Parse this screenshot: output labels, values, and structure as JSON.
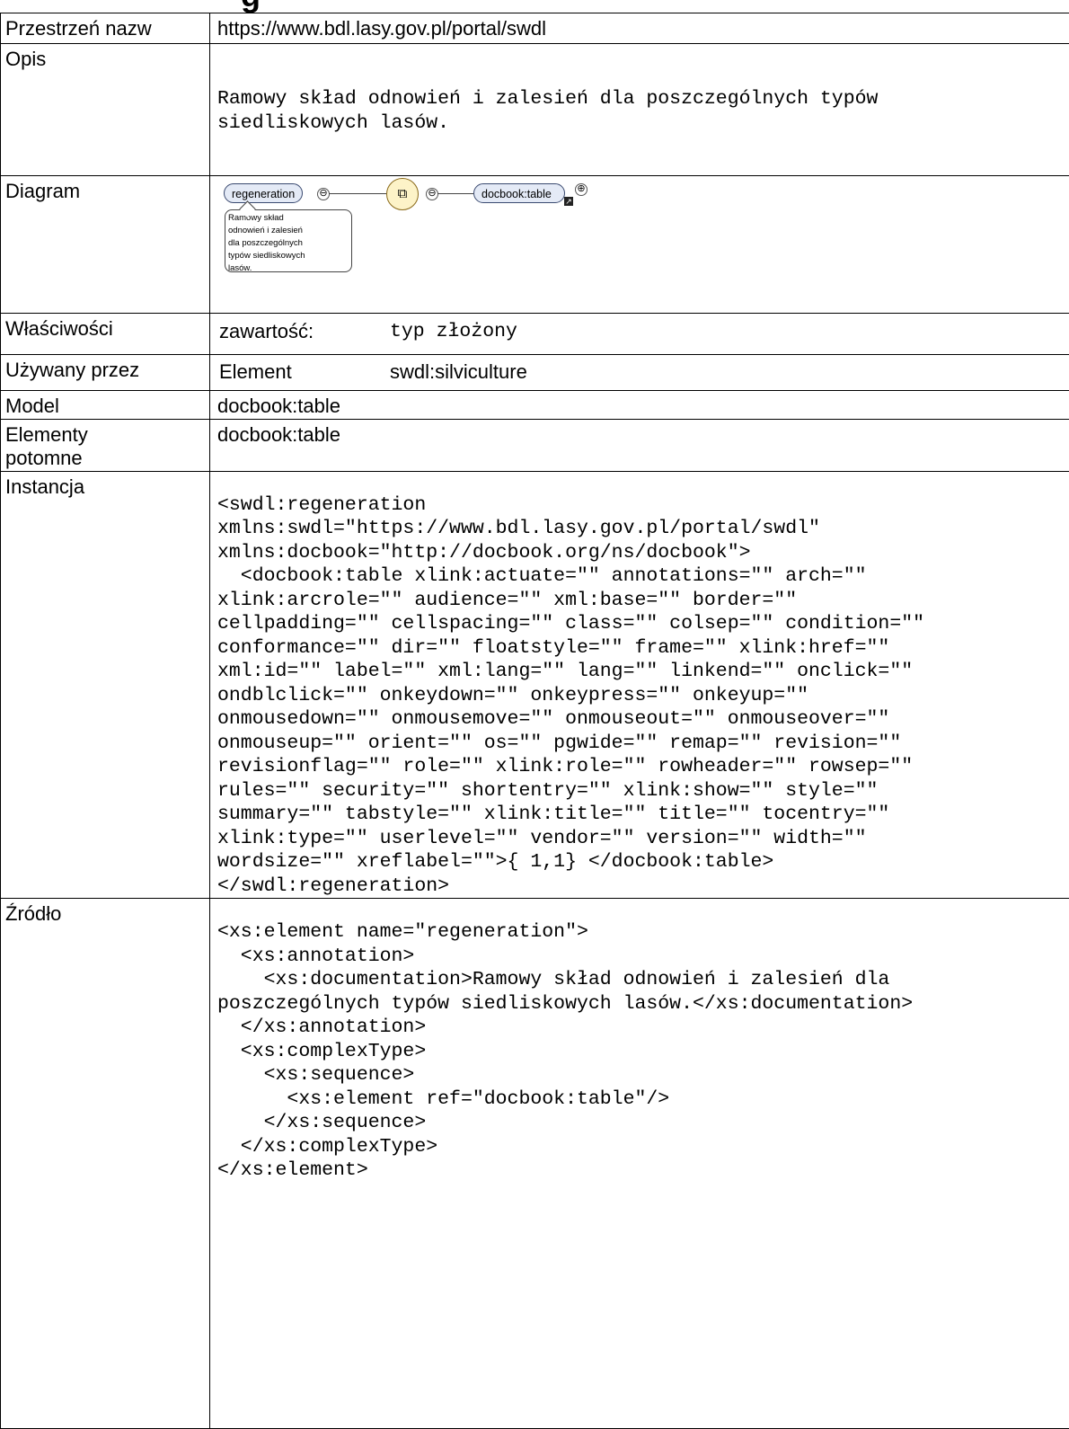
{
  "rows": {
    "namespace": {
      "label": "Przestrzeń nazw",
      "value": "https://www.bdl.lasy.gov.pl/portal/swdl"
    },
    "description": {
      "label": "Opis",
      "value": "Ramowy skład odnowień i zalesień dla poszczególnych typów\nsiedliskowych lasów."
    },
    "diagram": {
      "label": "Diagram",
      "node": "regeneration",
      "child": "docbook:table",
      "balloon": "Ramowy skład\nodnowień i zalesień\ndla poszczególnych\ntypów siedliskowych\nlasów.",
      "collapse_symbol": "⊖",
      "expand_symbol": "⊕"
    },
    "properties": {
      "label": "Właściwości",
      "key": "zawartość:",
      "value": "typ złożony"
    },
    "used_by": {
      "label": "Używany przez",
      "key": "Element",
      "value": "swdl:silviculture"
    },
    "model": {
      "label": "Model",
      "value": "docbook:table"
    },
    "children": {
      "label": "Elementy\npotomne",
      "value": "docbook:table"
    },
    "instance": {
      "label": "Instancja",
      "code": "<swdl:regeneration\nxmlns:swdl=\"https://www.bdl.lasy.gov.pl/portal/swdl\"\nxmlns:docbook=\"http://docbook.org/ns/docbook\">\n  <docbook:table xlink:actuate=\"\" annotations=\"\" arch=\"\"\nxlink:arcrole=\"\" audience=\"\" xml:base=\"\" border=\"\"\ncellpadding=\"\" cellspacing=\"\" class=\"\" colsep=\"\" condition=\"\"\nconformance=\"\" dir=\"\" floatstyle=\"\" frame=\"\" xlink:href=\"\"\nxml:id=\"\" label=\"\" xml:lang=\"\" lang=\"\" linkend=\"\" onclick=\"\"\nondblclick=\"\" onkeydown=\"\" onkeypress=\"\" onkeyup=\"\"\nonmousedown=\"\" onmousemove=\"\" onmouseout=\"\" onmouseover=\"\"\nonmouseup=\"\" orient=\"\" os=\"\" pgwide=\"\" remap=\"\" revision=\"\"\nrevisionflag=\"\" role=\"\" xlink:role=\"\" rowheader=\"\" rowsep=\"\"\nrules=\"\" security=\"\" shortentry=\"\" xlink:show=\"\" style=\"\"\nsummary=\"\" tabstyle=\"\" xlink:title=\"\" title=\"\" tocentry=\"\"\nxlink:type=\"\" userlevel=\"\" vendor=\"\" version=\"\" width=\"\"\nwordsize=\"\" xreflabel=\"\">{ 1,1} </docbook:table>\n</swdl:regeneration>"
    },
    "source": {
      "label": "Źródło",
      "code": "<xs:element name=\"regeneration\">\n  <xs:annotation>\n    <xs:documentation>Ramowy skład odnowień i zalesień dla\nposzczególnych typów siedliskowych lasów.</xs:documentation>\n  </xs:annotation>\n  <xs:complexType>\n    <xs:sequence>\n      <xs:element ref=\"docbook:table\"/>\n    </xs:sequence>\n  </xs:complexType>\n</xs:element>"
    }
  }
}
